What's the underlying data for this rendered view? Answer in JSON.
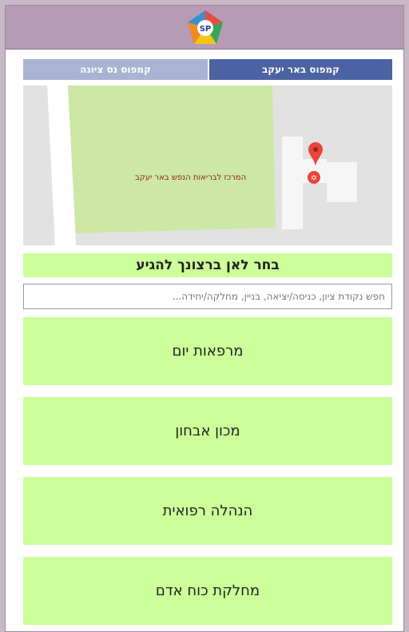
{
  "tabs": {
    "left_label": "קמפוס נס ציונה",
    "right_label": "קמפוס באר יעקב"
  },
  "map": {
    "location_label": "המרכז לבריאות הנפש באר יעקב"
  },
  "title": "בחר לאן ברצונך להגיע",
  "search": {
    "placeholder": "חפש נקודת ציון, כניסה/יציאה, בניין, מחלקה/יחידה..."
  },
  "destinations": [
    {
      "label": "מרפאות יום"
    },
    {
      "label": "מכון אבחון"
    },
    {
      "label": "הנהלה רפואית"
    },
    {
      "label": "מחלקת כוח אדם"
    }
  ],
  "colors": {
    "header": "#b79bb5",
    "tab_active": "#4c63a3",
    "tab_inactive": "#a9b4d3",
    "button_bg": "#ccff99",
    "map_park": "#cce8a4",
    "map_bg": "#e2e2e2",
    "pin": "#e8453c"
  }
}
